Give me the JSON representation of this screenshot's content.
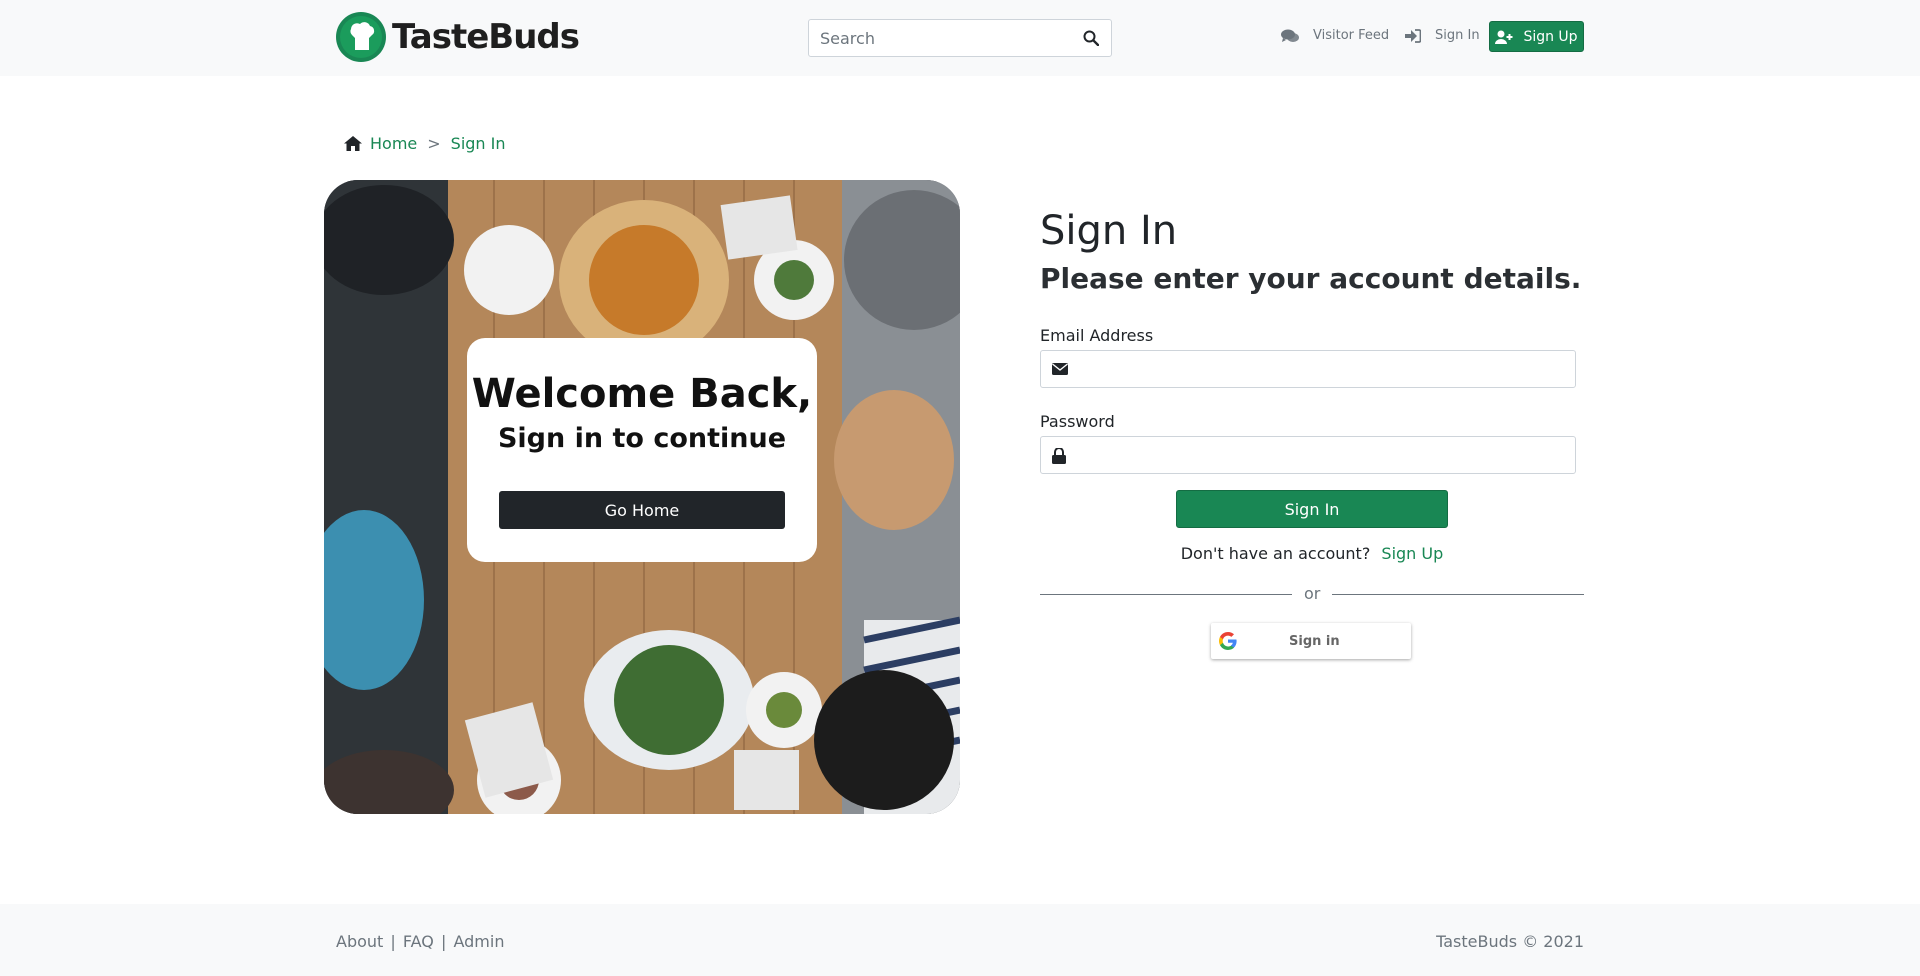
{
  "brand": {
    "name": "TasteBuds"
  },
  "search": {
    "placeholder": "Search"
  },
  "nav": {
    "visitor_feed": "Visitor Feed",
    "sign_in": "Sign In",
    "sign_up": "Sign Up"
  },
  "breadcrumb": {
    "home": "Home",
    "separator": ">",
    "current": "Sign In"
  },
  "hero": {
    "welcome_title": "Welcome Back,",
    "welcome_sub": "Sign in to continue",
    "go_home": "Go Home"
  },
  "form": {
    "title": "Sign In",
    "subtitle": "Please enter your account details.",
    "email_label": "Email Address",
    "email_value": "",
    "password_label": "Password",
    "password_value": "",
    "submit_label": "Sign In",
    "no_account_text": "Don't have an account?",
    "sign_up_link": "Sign Up",
    "divider_text": "or",
    "google_label": "Sign in"
  },
  "footer": {
    "about": "About",
    "faq": "FAQ",
    "admin": "Admin",
    "separator": "|",
    "copyright": "TasteBuds © 2021"
  },
  "colors": {
    "accent": "#198754",
    "dark_button": "#212529",
    "navbar_bg": "#f8f9fa"
  },
  "icons": [
    "logo-icon",
    "search-icon",
    "comments-icon",
    "sign-in-icon",
    "user-plus-icon",
    "home-icon",
    "envelope-icon",
    "lock-icon",
    "google-icon"
  ]
}
